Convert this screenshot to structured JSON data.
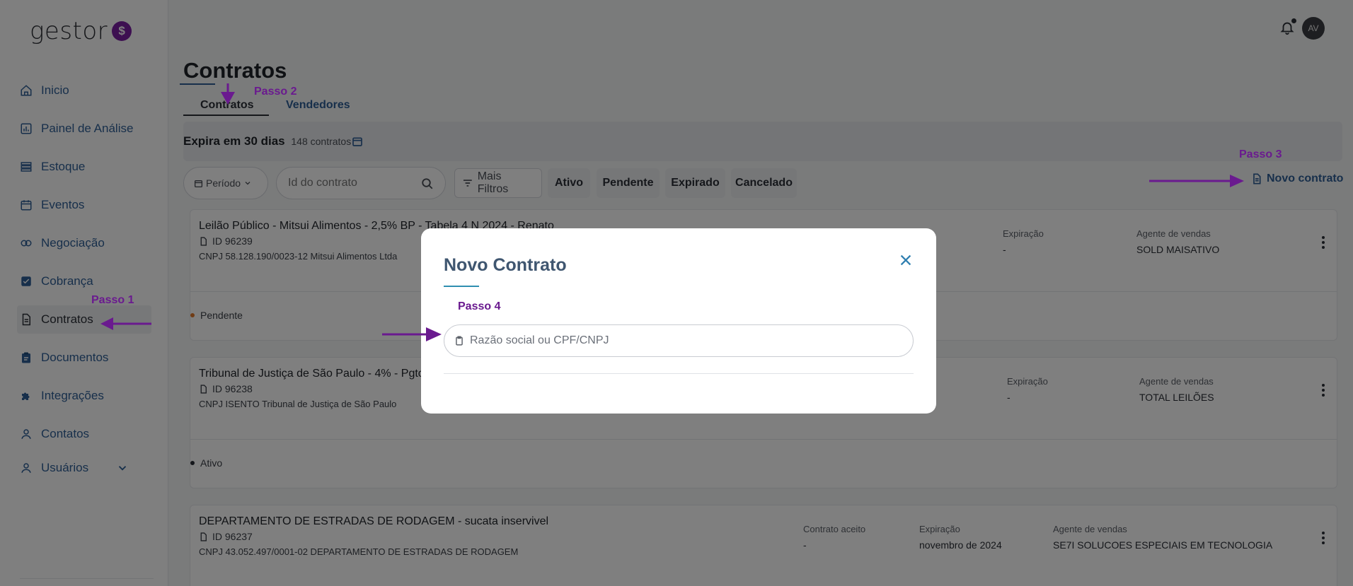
{
  "app": {
    "logo_text": "gestor",
    "logo_badge": "$"
  },
  "sidebar": {
    "items": [
      {
        "label": "Inicio",
        "icon": "home-icon"
      },
      {
        "label": "Painel de Análise",
        "icon": "chart-icon"
      },
      {
        "label": "Estoque",
        "icon": "list-icon"
      },
      {
        "label": "Eventos",
        "icon": "calendar-icon"
      },
      {
        "label": "Negociação",
        "icon": "handshake-icon"
      },
      {
        "label": "Cobrança",
        "icon": "checkbox-icon"
      },
      {
        "label": "Contratos",
        "icon": "document-icon"
      },
      {
        "label": "Documentos",
        "icon": "clipboard-icon"
      },
      {
        "label": "Integrações",
        "icon": "puzzle-icon"
      },
      {
        "label": "Contatos",
        "icon": "person-icon"
      },
      {
        "label": "Usuários",
        "icon": "user-icon"
      }
    ]
  },
  "header": {
    "avatar_initials": "AV"
  },
  "page": {
    "title": "Contratos",
    "tabs": {
      "contratos": "Contratos",
      "vendedores": "Vendedores"
    },
    "banner": {
      "title": "Expira em 30 dias",
      "count": "148 contratos"
    },
    "filters": {
      "periodo": "Período",
      "search_placeholder": "Id do contrato",
      "mais_filtros": "Mais Filtros",
      "ativo": "Ativo",
      "pendente": "Pendente",
      "expirado": "Expirado",
      "cancelado": "Cancelado"
    },
    "novo_contrato": "Novo contrato"
  },
  "contracts": [
    {
      "title": "Leilão Público - Mitsui Alimentos - 2,5% BP - Tabela 4 N 2024 - Renato",
      "id": "ID 96239",
      "cnpj": "CNPJ 58.128.190/0023-12 Mitsui Alimentos Ltda",
      "expiracao_label": "Expiração",
      "expiracao": "-",
      "agente_label": "Agente de vendas",
      "agente": "SOLD MAISATIVO",
      "status": "Pendente",
      "status_color": "#e0792b"
    },
    {
      "title": "Tribunal de Justiça de São Paulo - 4% - Pgto",
      "id": "ID 96238",
      "cnpj": "CNPJ ISENTO Tribunal de Justiça de São Paulo",
      "expiracao_label": "Expiração",
      "expiracao": "-",
      "agente_label": "Agente de vendas",
      "agente": "TOTAL LEILÕES",
      "status": "Ativo",
      "status_color": "#2b2f36"
    },
    {
      "title": "DEPARTAMENTO DE ESTRADAS DE RODAGEM - sucata inservivel",
      "id": "ID 96237",
      "cnpj": "CNPJ 43.052.497/0001-02 DEPARTAMENTO DE ESTRADAS DE RODAGEM",
      "aceito_label": "Contrato aceito",
      "aceito": "-",
      "expiracao_label": "Expiração",
      "expiracao": "novembro de 2024",
      "agente_label": "Agente de vendas",
      "agente": "SE7I SOLUCOES ESPECIAIS EM TECNOLOGIA"
    }
  ],
  "modal": {
    "title": "Novo Contrato",
    "input_placeholder": "Razão social ou CPF/CNPJ"
  },
  "annotations": {
    "passo1": "Passo 1",
    "passo2": "Passo 2",
    "passo3": "Passo 3",
    "passo4": "Passo 4",
    "color": "#6a1a8f"
  }
}
